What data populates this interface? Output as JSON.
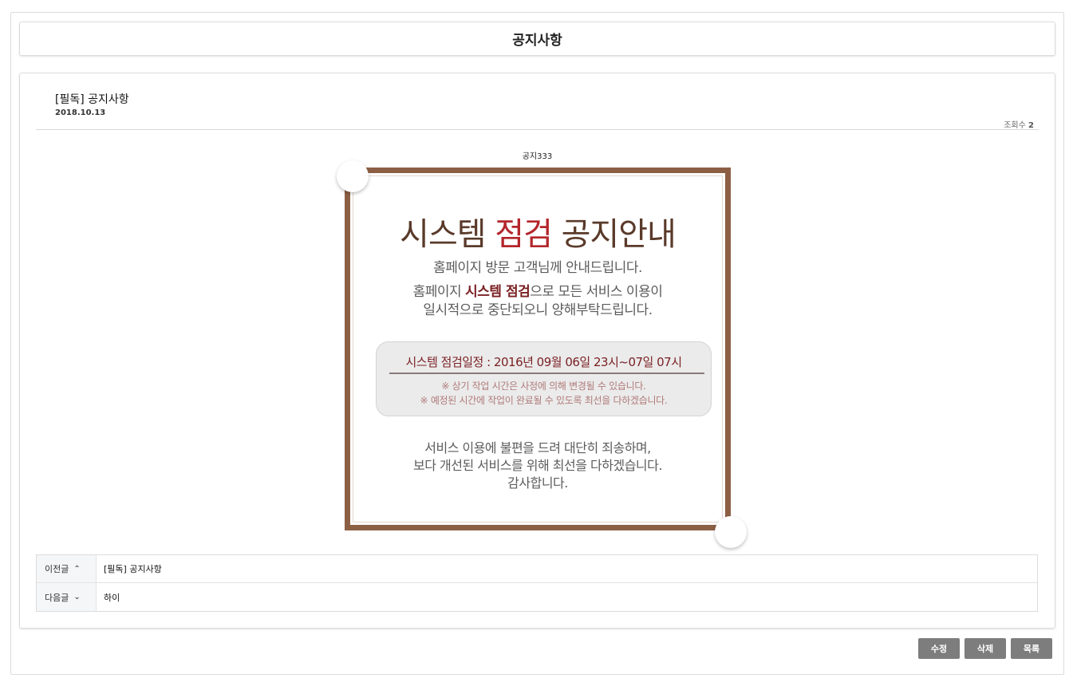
{
  "page_title": "공지사항",
  "post": {
    "title": "[필독] 공지사항",
    "date": "2018.10.13",
    "views_label": "조회수",
    "views_count": "2",
    "body_text": "공지333"
  },
  "notice_image": {
    "title_part1": "시스템",
    "title_highlight": "점검",
    "title_part2": "공지안내",
    "line1": "홈페이지 방문 고객님께 안내드립니다.",
    "line2_prefix": "홈페이지",
    "line2_bold": "시스템 점검",
    "line2_suffix": "으로 모든 서비스 이용이",
    "line3": "일시적으로 중단되오니 양해부탁드립니다.",
    "schedule_title": "시스템 점검일정 : 2016년 09월 06일 23시~07일 07시",
    "schedule_note1": "※ 상기 작업 시간은 사정에 의해 변경될 수 있습니다.",
    "schedule_note2": "※ 예정된 시간에 작업이 완료될 수 있도록 최선을 다하겠습니다.",
    "closing1": "서비스 이용에 불편을 드려 대단히 죄송하며,",
    "closing2": "보다 개선된 서비스를 위해 최선을 다하겠습니다.",
    "closing3": "감사합니다."
  },
  "navigation": {
    "prev_label": "이전글",
    "prev_icon": "chevron-up-icon",
    "prev_title": "[필독] 공지사항",
    "next_label": "다음글",
    "next_icon": "chevron-down-icon",
    "next_title": "하이"
  },
  "buttons": {
    "edit": "수정",
    "delete": "삭제",
    "list": "목록"
  },
  "colors": {
    "frame_brown": "#8c5f45",
    "highlight_red": "#b3262b",
    "button_gray": "#7d7d7d"
  }
}
